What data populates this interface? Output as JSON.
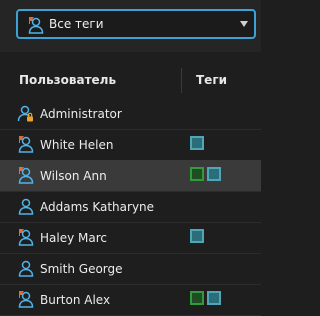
{
  "filter": {
    "label": "Все теги"
  },
  "table": {
    "columns": {
      "user": "Пользователь",
      "tags": "Теги"
    },
    "rows": [
      {
        "name": "Administrator",
        "icon": "user-lock-icon",
        "tags": []
      },
      {
        "name": "White Helen",
        "icon": "user-flag-icon",
        "tags": [
          "teal"
        ]
      },
      {
        "name": "Wilson Ann",
        "icon": "user-flag-icon",
        "tags": [
          "green",
          "teal"
        ],
        "selected": true
      },
      {
        "name": "Addams Katharyne",
        "icon": "user-icon",
        "tags": []
      },
      {
        "name": "Haley Marc",
        "icon": "user-flag-icon",
        "tags": [
          "teal"
        ]
      },
      {
        "name": "Smith George",
        "icon": "user-icon",
        "tags": []
      },
      {
        "name": "Burton Alex",
        "icon": "user-flag-icon",
        "tags": [
          "green",
          "teal"
        ]
      }
    ]
  },
  "colors": {
    "accent": "#3aa2d6",
    "user_icon": "#4fb3e8",
    "flag": "#e06c3c",
    "lock": "#e8a630",
    "tag_teal": "#4ea6b6",
    "tag_green": "#2f9b3a",
    "selected_row": "#3a3a3a"
  }
}
